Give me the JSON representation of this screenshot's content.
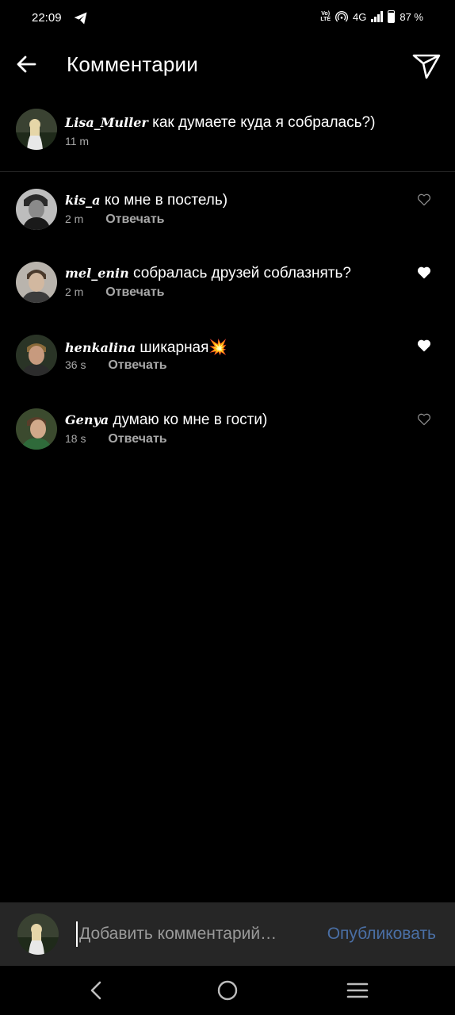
{
  "status": {
    "time": "22:09",
    "volte_top": "Vo)",
    "volte_bottom": "LTE",
    "network": "4G",
    "battery": "87 %"
  },
  "header": {
    "title": "Комментарии"
  },
  "caption": {
    "username": "Lisa_Muller",
    "text": "как думаете куда я собралась?)",
    "time": "11 m"
  },
  "comments": [
    {
      "username": "kis_a",
      "text": "ко мне в постель)",
      "time": "2 m",
      "reply": "Отвечать",
      "liked": false
    },
    {
      "username": "mel_enin",
      "text": "собралась друзей соблазнять?",
      "time": "2 m",
      "reply": "Отвечать",
      "liked": true
    },
    {
      "username": "henkalina",
      "text": "шикарная💥",
      "time": "36 s",
      "reply": "Отвечать",
      "liked": true
    },
    {
      "username": "Genya",
      "text": "думаю ко мне в гости)",
      "time": "18 s",
      "reply": "Отвечать",
      "liked": false
    }
  ],
  "composer": {
    "placeholder": "Добавить комментарий…",
    "publish": "Опубликовать"
  },
  "colors": {
    "background": "#000000",
    "composer_bg": "#262626",
    "publish": "#4a6fa5",
    "meta": "#a8a8a8"
  }
}
